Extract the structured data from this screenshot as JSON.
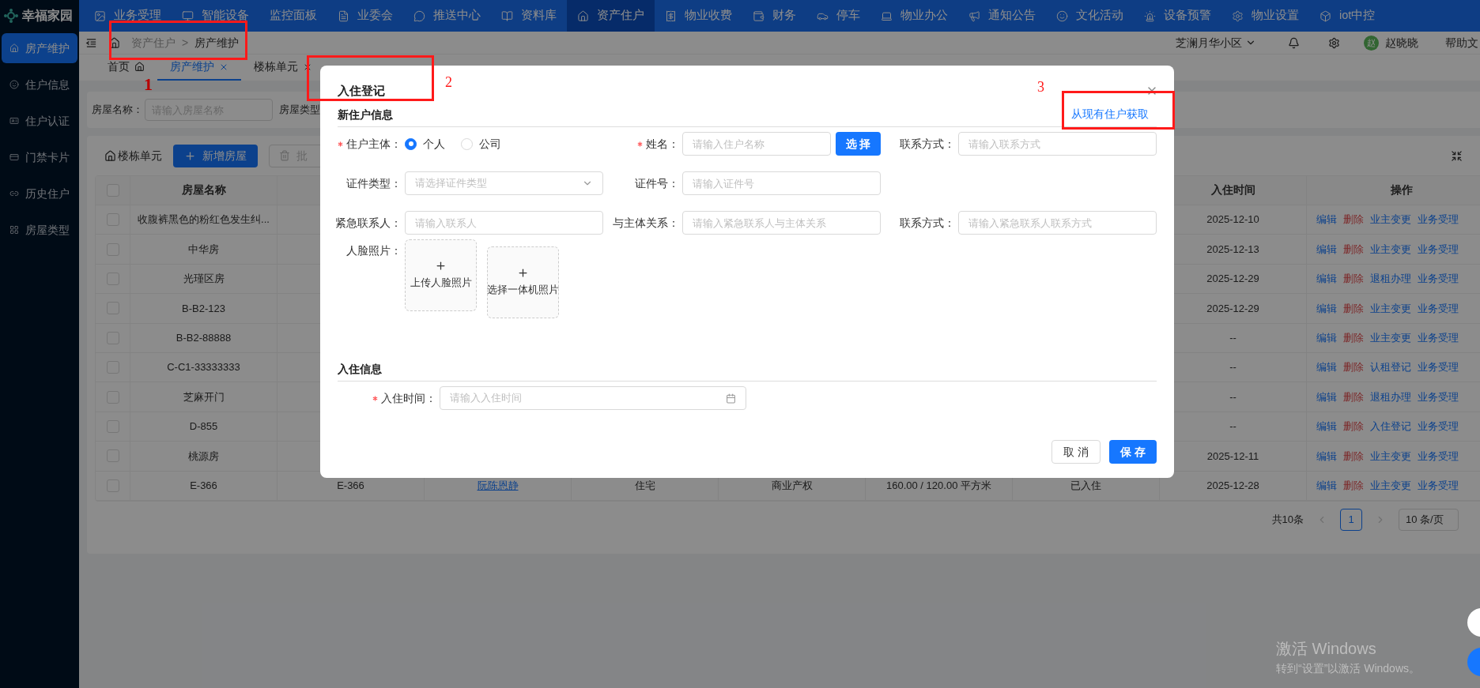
{
  "app": {
    "logo": "幸福家园"
  },
  "top_nav": [
    {
      "label": "业务受理",
      "selected": false
    },
    {
      "label": "智能设备",
      "selected": false
    },
    {
      "label": "监控面板",
      "selected": false
    },
    {
      "label": "业委会",
      "selected": false
    },
    {
      "label": "推送中心",
      "selected": false
    },
    {
      "label": "资料库",
      "selected": false
    },
    {
      "label": "资产住户",
      "selected": true
    },
    {
      "label": "物业收费",
      "selected": false
    },
    {
      "label": "财务",
      "selected": false
    },
    {
      "label": "停车",
      "selected": false
    },
    {
      "label": "物业办公",
      "selected": false
    },
    {
      "label": "通知公告",
      "selected": false
    },
    {
      "label": "文化活动",
      "selected": false
    },
    {
      "label": "设备预警",
      "selected": false
    },
    {
      "label": "物业设置",
      "selected": false
    },
    {
      "label": "iot中控",
      "selected": false
    }
  ],
  "sidebar": {
    "items": [
      {
        "label": "房产维护",
        "selected": true
      },
      {
        "label": "住户信息",
        "selected": false
      },
      {
        "label": "住户认证",
        "selected": false
      },
      {
        "label": "门禁卡片",
        "selected": false
      },
      {
        "label": "历史住户",
        "selected": false
      },
      {
        "label": "房屋类型",
        "selected": false
      }
    ]
  },
  "header": {
    "breadcrumb": [
      "资产住户",
      "房产维护"
    ],
    "separator": ">",
    "community": "芝澜月华小区",
    "avatar": "赵",
    "user": "赵晓晓",
    "help": "帮助文"
  },
  "tabs": [
    {
      "label": "首页",
      "kind": "home",
      "selected": false
    },
    {
      "label": "房产维护",
      "kind": "closable",
      "selected": true
    },
    {
      "label": "楼栋单元",
      "kind": "closable",
      "selected": false
    }
  ],
  "filter": {
    "label": "房屋名称：",
    "placeholder": "请输入房屋名称",
    "label_2": "房屋类型"
  },
  "toolbar": {
    "building": "楼栋单元",
    "add": "新增房屋",
    "batch": "批"
  },
  "table": {
    "header_checked": false,
    "columns": {
      "name": "房屋名称",
      "checkin": "入住时间",
      "actions": "操作"
    },
    "rows": [
      {
        "checked": false,
        "name": "收腹裤黑色的粉红色发生纠...",
        "checkin": "2025-12-10",
        "actions": [
          {
            "label": "编辑",
            "kind": "link"
          },
          {
            "label": "删除",
            "kind": "danger"
          },
          {
            "label": "业主变更",
            "kind": "link"
          },
          {
            "label": "业务受理",
            "kind": "link"
          }
        ]
      },
      {
        "checked": false,
        "name": "中华房",
        "checkin": "2025-12-13",
        "actions": [
          {
            "label": "编辑",
            "kind": "link"
          },
          {
            "label": "删除",
            "kind": "danger"
          },
          {
            "label": "业主变更",
            "kind": "link"
          },
          {
            "label": "业务受理",
            "kind": "link"
          }
        ]
      },
      {
        "checked": false,
        "name": "光瑾区房",
        "checkin": "2025-12-29",
        "actions": [
          {
            "label": "编辑",
            "kind": "link"
          },
          {
            "label": "删除",
            "kind": "danger"
          },
          {
            "label": "退租办理",
            "kind": "link"
          },
          {
            "label": "业务受理",
            "kind": "link"
          }
        ]
      },
      {
        "checked": false,
        "name": "B-B2-123",
        "checkin": "2025-12-29",
        "actions": [
          {
            "label": "编辑",
            "kind": "link"
          },
          {
            "label": "删除",
            "kind": "danger"
          },
          {
            "label": "业主变更",
            "kind": "link"
          },
          {
            "label": "业务受理",
            "kind": "link"
          }
        ]
      },
      {
        "checked": false,
        "name": "B-B2-88888",
        "checkin": "--",
        "actions": [
          {
            "label": "编辑",
            "kind": "link"
          },
          {
            "label": "删除",
            "kind": "danger"
          },
          {
            "label": "业主变更",
            "kind": "link"
          },
          {
            "label": "业务受理",
            "kind": "link"
          }
        ]
      },
      {
        "checked": false,
        "name": "C-C1-33333333",
        "checkin": "--",
        "actions": [
          {
            "label": "编辑",
            "kind": "link"
          },
          {
            "label": "删除",
            "kind": "danger"
          },
          {
            "label": "认租登记",
            "kind": "link"
          },
          {
            "label": "业务受理",
            "kind": "link"
          }
        ]
      },
      {
        "checked": false,
        "name": "芝麻开门",
        "checkin": "--",
        "actions": [
          {
            "label": "编辑",
            "kind": "link"
          },
          {
            "label": "删除",
            "kind": "danger"
          },
          {
            "label": "退租办理",
            "kind": "link"
          },
          {
            "label": "业务受理",
            "kind": "link"
          }
        ]
      },
      {
        "checked": false,
        "name": "D-855",
        "checkin": "--",
        "actions": [
          {
            "label": "编辑",
            "kind": "link"
          },
          {
            "label": "删除",
            "kind": "danger"
          },
          {
            "label": "入住登记",
            "kind": "link"
          },
          {
            "label": "业务受理",
            "kind": "link"
          }
        ]
      },
      {
        "checked": false,
        "name": "桃源房",
        "checkin": "2025-12-11",
        "actions": [
          {
            "label": "编辑",
            "kind": "link"
          },
          {
            "label": "删除",
            "kind": "danger"
          },
          {
            "label": "业主变更",
            "kind": "link"
          },
          {
            "label": "业务受理",
            "kind": "link"
          }
        ]
      },
      {
        "checked": false,
        "name": "E-366",
        "code": "E-366",
        "owner": "阮陈恩静",
        "type": "住宅",
        "property": "商业产权",
        "area": "160.00 / 120.00 平方米",
        "status": "已入住",
        "checkin": "2025-12-28",
        "actions": [
          {
            "label": "编辑",
            "kind": "link"
          },
          {
            "label": "删除",
            "kind": "danger"
          },
          {
            "label": "业主变更",
            "kind": "link"
          },
          {
            "label": "业务受理",
            "kind": "link"
          }
        ]
      }
    ]
  },
  "pagination": {
    "total": "共10条",
    "pages": [
      {
        "label": "1",
        "selected": true
      }
    ],
    "page_size": "10 条/页"
  },
  "modal": {
    "title": "入住登记",
    "fetch_link": "从现有住户获取",
    "new_resident": {
      "title": "新住户信息",
      "rows": [
        [
          {
            "label": "住户主体：",
            "required": true,
            "kind": "radio",
            "options": [
              {
                "label": "个人",
                "selected": true
              },
              {
                "label": "公司",
                "selected": false
              }
            ]
          },
          {
            "label": "姓名：",
            "required": true,
            "kind": "input",
            "placeholder": "请输入住户名称",
            "button": "选 择"
          },
          {
            "label": "联系方式：",
            "required": false,
            "kind": "input",
            "placeholder": "请输入联系方式"
          }
        ],
        [
          {
            "label": "证件类型：",
            "required": false,
            "kind": "select",
            "placeholder": "请选择证件类型"
          },
          {
            "label": "证件号：",
            "required": false,
            "kind": "input",
            "placeholder": "请输入证件号"
          },
          null
        ],
        [
          {
            "label": "紧急联系人：",
            "required": false,
            "kind": "input",
            "placeholder": "请输入联系人"
          },
          {
            "label": "与主体关系：",
            "required": false,
            "kind": "input",
            "placeholder": "请输入紧急联系人与主体关系"
          },
          {
            "label": "联系方式：",
            "required": false,
            "kind": "input",
            "placeholder": "请输入紧急联系人联系方式"
          }
        ]
      ],
      "photos": {
        "label": "人脸照片：",
        "uploads": [
          "上传人脸照片",
          "选择一体机照片"
        ]
      }
    },
    "checkin": {
      "title": "入住信息",
      "field": {
        "label": "入住时间：",
        "required": true,
        "kind": "date",
        "placeholder": "请输入入住时间"
      }
    },
    "buttons": [
      {
        "label": "取 消",
        "kind": "default"
      },
      {
        "label": "保 存",
        "kind": "primary"
      }
    ]
  },
  "annotations": [
    {
      "label": "1"
    },
    {
      "label": "2"
    },
    {
      "label": "3"
    }
  ],
  "os_notice": {
    "title": "激活 Windows",
    "text": "转到“设置”以激活 Windows。"
  }
}
